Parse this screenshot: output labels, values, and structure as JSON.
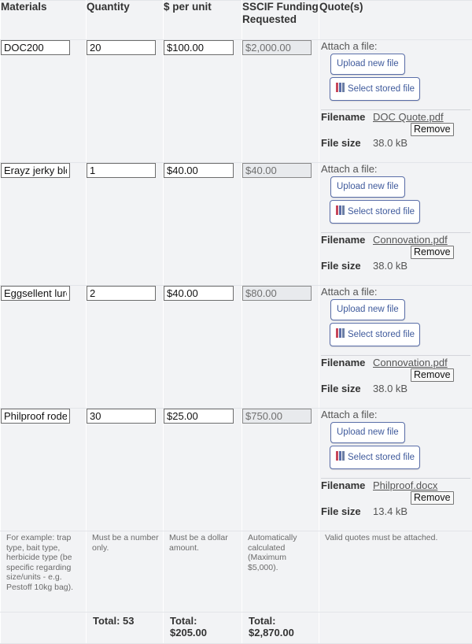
{
  "headers": {
    "materials": "Materials",
    "quantity": "Quantity",
    "per_unit": "$ per unit",
    "sscif": "SSCIF Funding Requested",
    "quotes": "Quote(s)"
  },
  "labels": {
    "attach": "Attach a file:",
    "upload": "Upload new file",
    "select_stored": "Select stored file",
    "filename": "Filename",
    "file_size": "File size",
    "remove": "Remove"
  },
  "rows": [
    {
      "material": "DOC200",
      "quantity": "20",
      "per_unit": "$100.00",
      "funding": "$2,000.00",
      "filename": "DOC Quote.pdf",
      "filesize": "38.0 kB"
    },
    {
      "material": "Erayz jerky blö",
      "quantity": "1",
      "per_unit": "$40.00",
      "funding": "$40.00",
      "filename": "Connovation.pdf",
      "filesize": "38.0 kB"
    },
    {
      "material": "Eggsellent lure",
      "quantity": "2",
      "per_unit": "$40.00",
      "funding": "$80.00",
      "filename": "Connovation.pdf",
      "filesize": "38.0 kB"
    },
    {
      "material": "Philproof rode",
      "quantity": "30",
      "per_unit": "$25.00",
      "funding": "$750.00",
      "filename": "Philproof.docx",
      "filesize": "13.4 kB"
    }
  ],
  "help": {
    "materials": "For example: trap type, bait type, herbicide type (be specific regarding size/units - e.g. Pestoff 10kg bag).",
    "quantity": "Must be a number only.",
    "per_unit": "Must be a dollar amount.",
    "sscif": "Automatically calculated (Maximum $5,000).",
    "quotes": "Valid quotes must be attached."
  },
  "totals": {
    "quantity": "Total: 53",
    "per_unit_label": "Total:",
    "per_unit_value": "$205.00",
    "funding_label": "Total:",
    "funding_value": "$2,870.00"
  },
  "colors": {
    "background": "#f2f3f5",
    "button_text": "#3f5a9c",
    "icon_books": [
      "#c8475a",
      "#5b6fa8",
      "#6c7fa5"
    ]
  }
}
